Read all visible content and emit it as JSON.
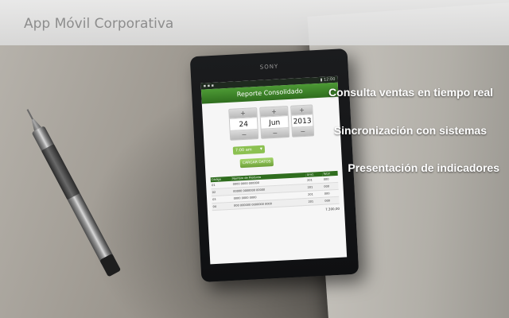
{
  "banner": {
    "title": "App Móvil Corporativa"
  },
  "features": [
    "Consulta ventas en tiempo real",
    "Sincronización con sistemas",
    "Presentación de indicadores"
  ],
  "phone": {
    "brand": "SONY",
    "statusbar": {
      "left": "▪ ▪ ▪",
      "right": "▮ 12:00"
    },
    "app_title": "Reporte Consolidado",
    "date": {
      "day": "24",
      "month": "Jun",
      "year": "2013"
    },
    "stepper": {
      "plus": "+",
      "minus": "−"
    },
    "select_value": "7:00 am",
    "load_button": "CARGAR DATOS",
    "table": {
      "headers": [
        "Código",
        "Nombre de Producto",
        "Unid.",
        "Total"
      ],
      "rows": [
        [
          "01",
          "0000 0000 000000",
          "201",
          "000"
        ],
        [
          "02",
          "00000 0000000 00000",
          "201",
          "000"
        ],
        [
          "03",
          "0000 0000 0000",
          "201",
          "000"
        ],
        [
          "04",
          "000 000000 0000000 0000",
          "201",
          "000"
        ]
      ],
      "total": "7.300,00"
    }
  },
  "colors": {
    "header_green": "#2f6d1e",
    "accent_green": "#8cc151",
    "banner_text": "#8d8d8d"
  }
}
